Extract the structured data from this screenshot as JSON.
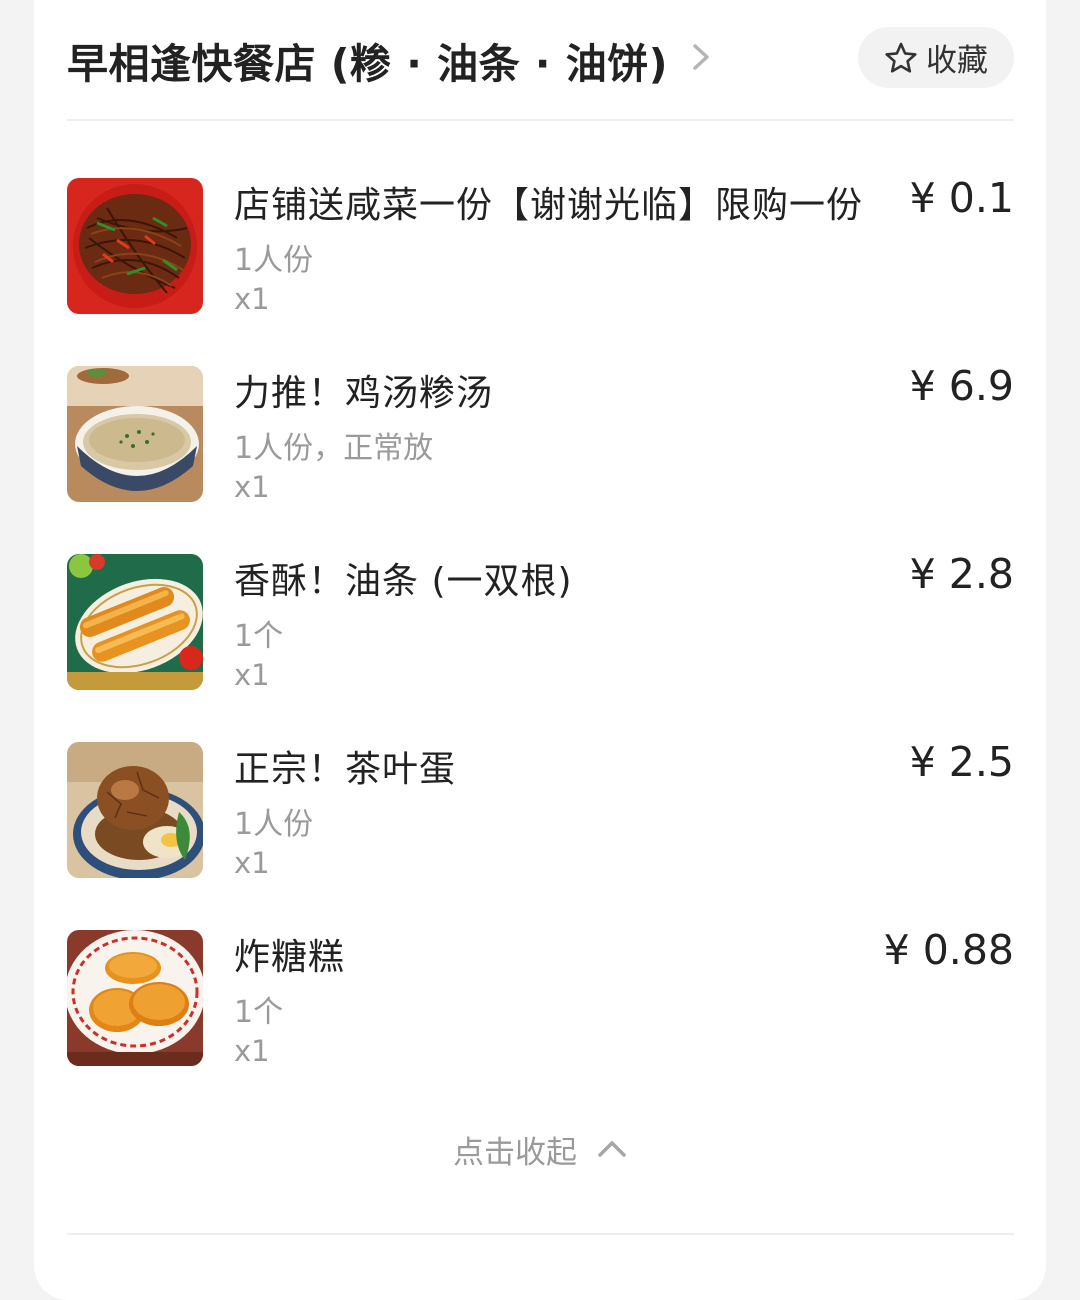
{
  "shop": {
    "name": "早相逢快餐店 (糁 · 油条 · 油饼)",
    "favorite_label": "收藏"
  },
  "items": [
    {
      "name": "店铺送咸菜一份【谢谢光临】限购一份",
      "spec": "1人份",
      "qty": "x1",
      "price": "¥ 0.1",
      "icon": "pickled-vegetables"
    },
    {
      "name": "力推！鸡汤糁汤",
      "spec": "1人份，正常放",
      "qty": "x1",
      "price": "¥ 6.9",
      "icon": "soup-bowl"
    },
    {
      "name": "香酥！油条 (一双根)",
      "spec": "1个",
      "qty": "x1",
      "price": "¥ 2.8",
      "icon": "fried-dough-sticks"
    },
    {
      "name": "正宗！茶叶蛋",
      "spec": "1人份",
      "qty": "x1",
      "price": "¥ 2.5",
      "icon": "tea-egg"
    },
    {
      "name": "炸糖糕",
      "spec": "1个",
      "qty": "x1",
      "price": "¥ 0.88",
      "icon": "fried-sugar-cakes"
    }
  ],
  "collapse": {
    "label": "点击收起"
  }
}
